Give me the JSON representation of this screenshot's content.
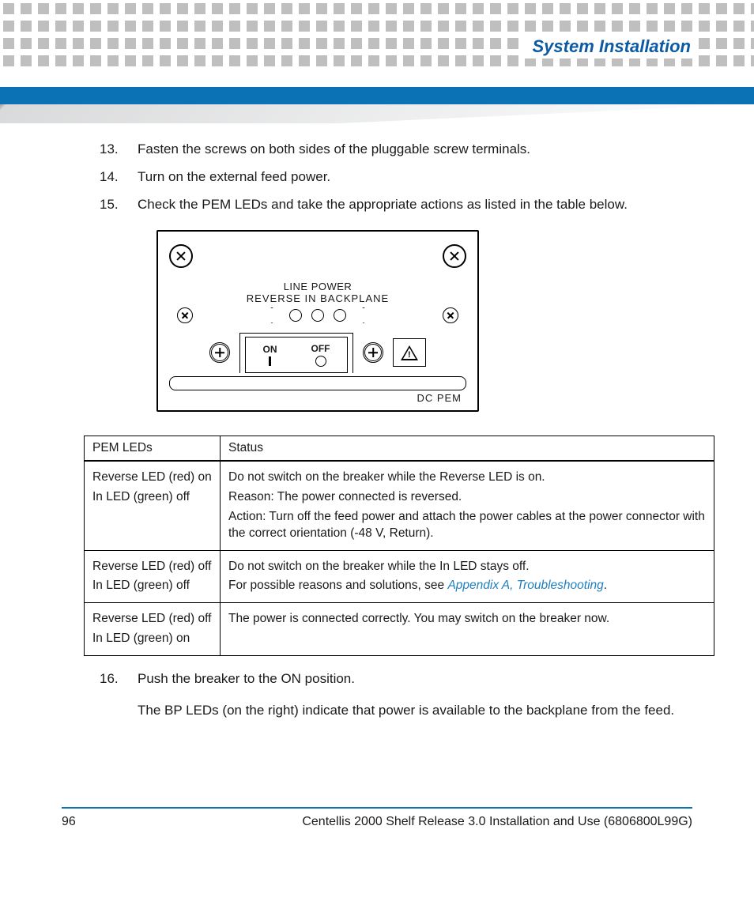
{
  "header": {
    "title": "System Installation"
  },
  "steps": {
    "s13": {
      "num": "13.",
      "text": "Fasten the screws on both sides of the pluggable screw terminals."
    },
    "s14": {
      "num": "14.",
      "text": "Turn on the external feed power."
    },
    "s15": {
      "num": "15.",
      "text": "Check the PEM LEDs and take the appropriate actions as listed in the table below."
    },
    "s16": {
      "num": "16.",
      "text": "Push the breaker to the ON position."
    },
    "s16b": "The BP LEDs (on the right) indicate that power is available to the backplane from the feed."
  },
  "diagram": {
    "line_power": "LINE POWER",
    "sublabels": "REVERSE   IN   BACKPLANE",
    "on": "ON",
    "off": "OFF",
    "dcpem": "DC PEM"
  },
  "table": {
    "headers": {
      "leds": "PEM LEDs",
      "status": "Status"
    },
    "rows": [
      {
        "led1": "Reverse LED (red) on",
        "led2": "In LED (green) off",
        "status": [
          "Do not switch on the breaker while the Reverse LED is on.",
          "Reason: The power connected is reversed.",
          "Action: Turn off the feed power and attach the power cables at the power connector with the correct orientation (-48 V, Return)."
        ]
      },
      {
        "led1": "Reverse LED (red) off",
        "led2": "In LED (green) off",
        "status_pre": "Do not switch on the breaker while the In LED stays off.",
        "status_link_pre": "For possible reasons and solutions, see ",
        "status_link": "Appendix A, Troubleshooting",
        "status_post": "."
      },
      {
        "led1": "Reverse LED (red) off",
        "led2": "In LED (green) on",
        "status": [
          "The power is connected correctly. You may switch on the breaker now."
        ]
      }
    ]
  },
  "footer": {
    "page": "96",
    "doc": "Centellis 2000 Shelf Release 3.0 Installation and Use (6806800L99G)"
  }
}
